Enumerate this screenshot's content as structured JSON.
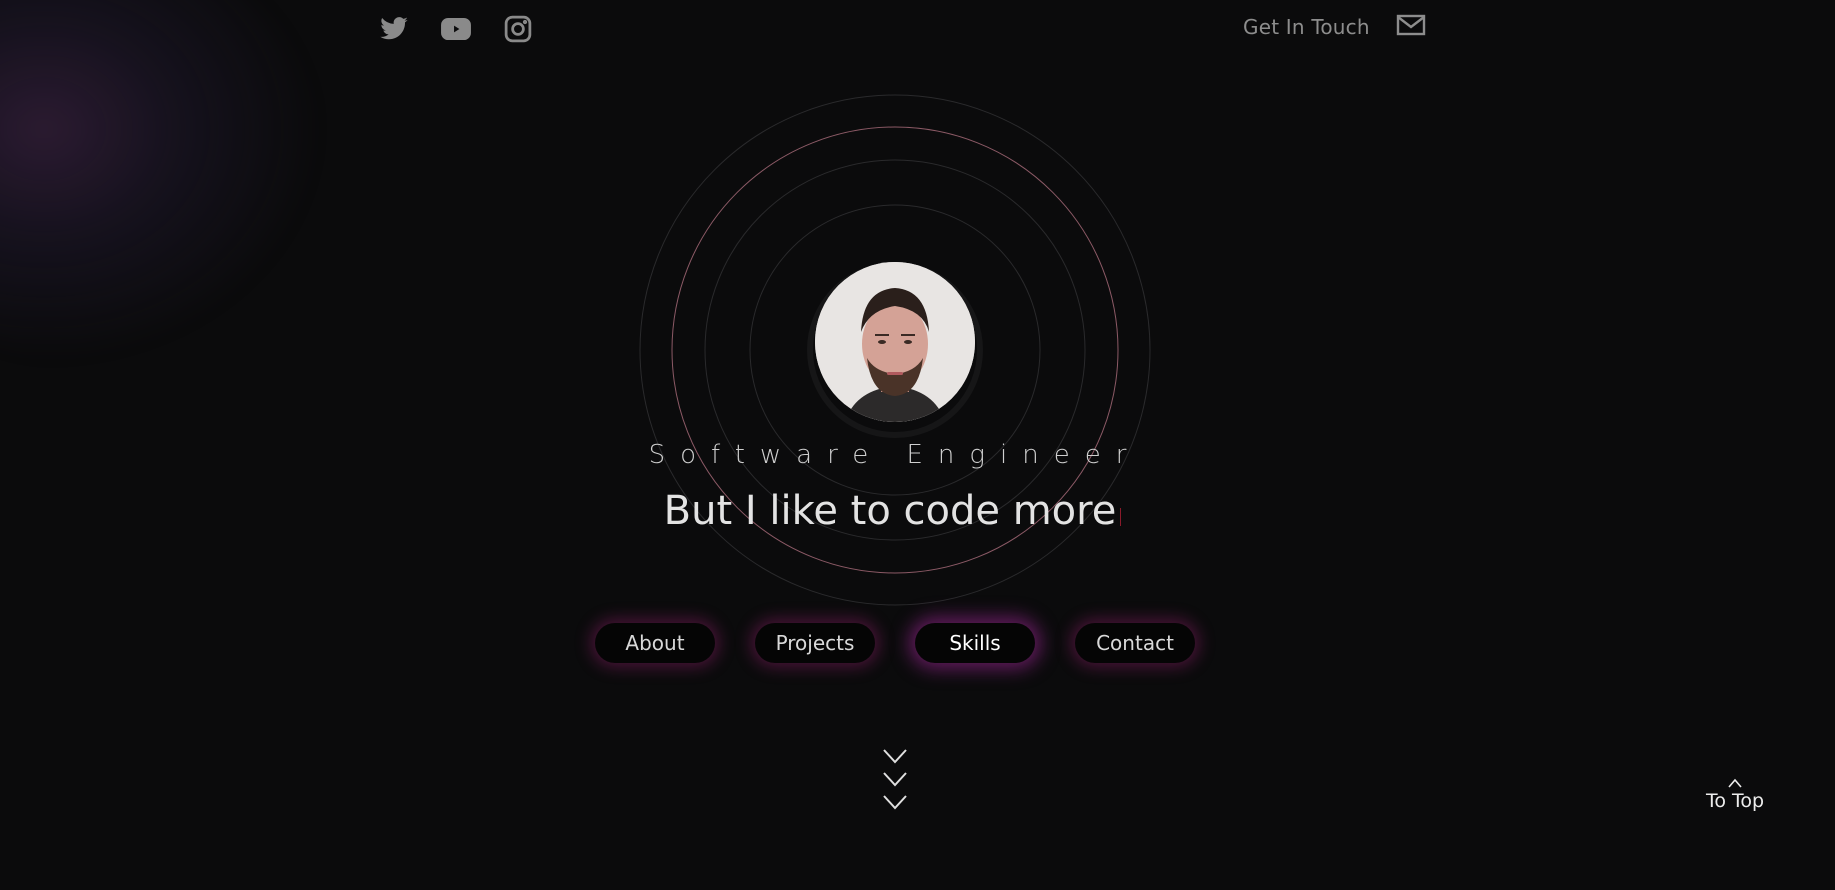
{
  "header": {
    "social": [
      {
        "name": "twitter-icon"
      },
      {
        "name": "youtube-icon"
      },
      {
        "name": "instagram-icon"
      }
    ],
    "get_in_touch_label": "Get In Touch",
    "mail_icon": "mail-icon"
  },
  "hero": {
    "subtitle": "Software Engineer",
    "tagline": "But I like to code more"
  },
  "nav": {
    "items": [
      {
        "label": "About"
      },
      {
        "label": "Projects"
      },
      {
        "label": "Skills"
      },
      {
        "label": "Contact"
      }
    ],
    "active": "Skills"
  },
  "scroll_icon": "chevrons-down-icon",
  "to_top": {
    "label": "To Top"
  },
  "colors": {
    "background": "#0b0b0c",
    "accent_glow": "#9a1e6e",
    "ring_accent": "#b07080",
    "text": "#e3e3e3"
  }
}
